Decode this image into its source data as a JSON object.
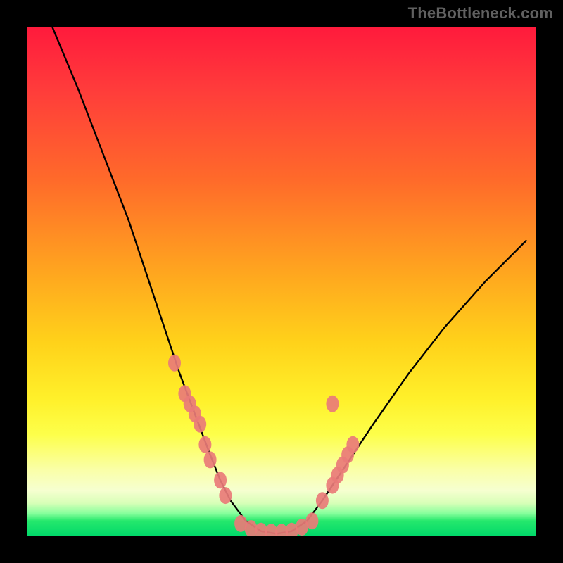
{
  "watermark": {
    "text": "TheBottleneck.com"
  },
  "chart_data": {
    "type": "line",
    "title": "",
    "xlabel": "",
    "ylabel": "",
    "xlim": [
      0,
      100
    ],
    "ylim": [
      0,
      100
    ],
    "grid": false,
    "legend": false,
    "series": [
      {
        "name": "curve",
        "x": [
          5,
          10,
          15,
          20,
          25,
          28,
          30,
          33,
          36,
          38,
          40,
          43,
          46,
          49,
          52,
          55,
          58,
          62,
          68,
          75,
          82,
          90,
          98
        ],
        "y": [
          100,
          88,
          75,
          62,
          47,
          38,
          32,
          24,
          16,
          11,
          7,
          3,
          1,
          0.5,
          1,
          3,
          7,
          13,
          22,
          32,
          41,
          50,
          58
        ]
      }
    ],
    "markers": [
      {
        "name": "left-cluster",
        "x": [
          29,
          31,
          32,
          33,
          34,
          35,
          36,
          38,
          39
        ],
        "y": [
          34,
          28,
          26,
          24,
          22,
          18,
          15,
          11,
          8
        ]
      },
      {
        "name": "bottom-cluster",
        "x": [
          42,
          44,
          46,
          48,
          50,
          52,
          54,
          56
        ],
        "y": [
          2.5,
          1.5,
          1,
          0.8,
          0.8,
          1,
          1.8,
          3
        ]
      },
      {
        "name": "right-cluster",
        "x": [
          58,
          60,
          61,
          62,
          63,
          64,
          60
        ],
        "y": [
          7,
          10,
          12,
          14,
          16,
          18,
          26
        ]
      }
    ],
    "marker_color": "#e97b78",
    "curve_color": "#000000"
  }
}
